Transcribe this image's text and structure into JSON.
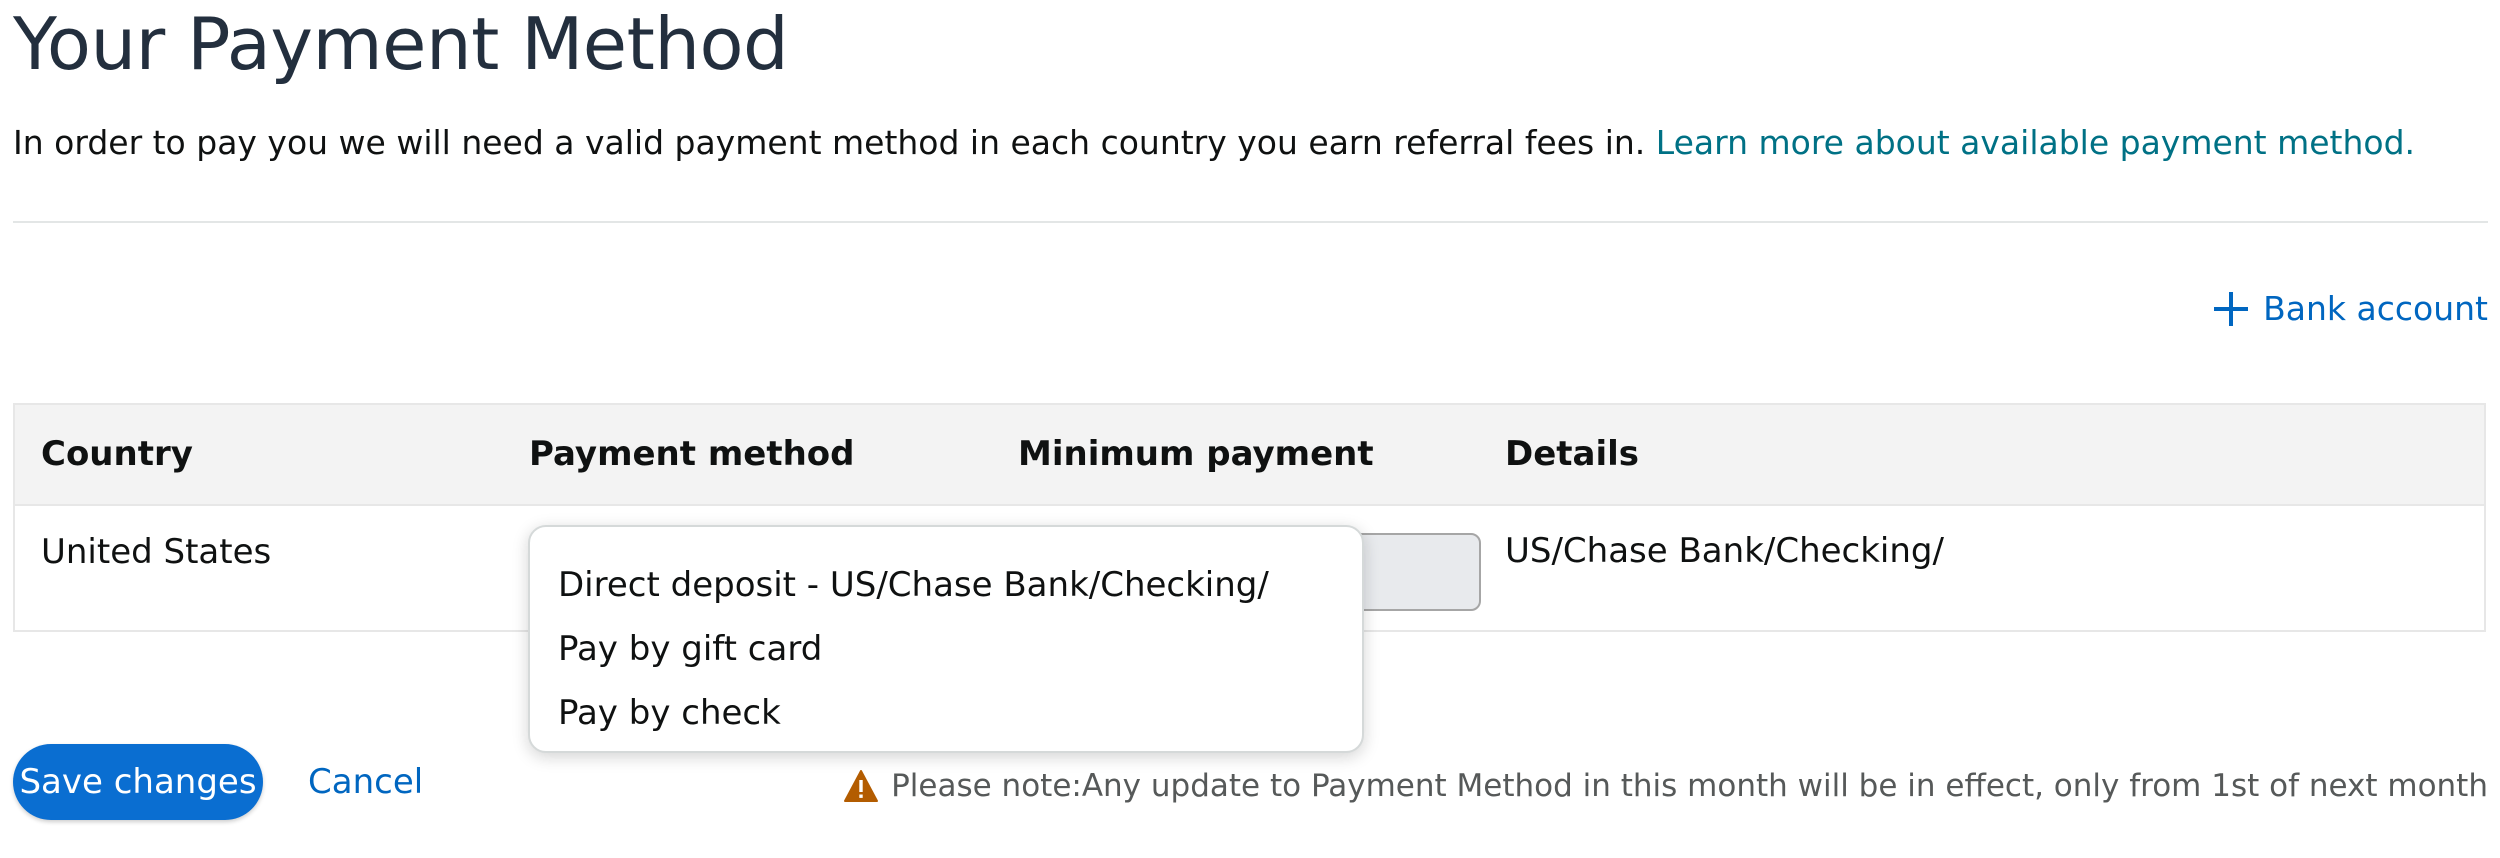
{
  "page": {
    "title": "Your Payment Method",
    "intro_text": "In order to pay you we will need a valid payment method in each country you earn referral fees in. ",
    "intro_link": "Learn more about available payment method."
  },
  "actions": {
    "add_bank_label": "Bank account",
    "save_label": "Save changes",
    "cancel_label": "Cancel"
  },
  "table": {
    "headers": [
      "Country",
      "Payment method",
      "Minimum payment",
      "Details"
    ],
    "rows": [
      {
        "country": "United States",
        "payment_method": "Direct deposit - US/Chase Bank/Checking/",
        "minimum_payment": "",
        "details": "US/Chase Bank/Checking/"
      }
    ]
  },
  "payment_dropdown": {
    "options": [
      "Direct deposit - US/Chase Bank/Checking/",
      "Pay by gift card",
      "Pay by check"
    ]
  },
  "note": {
    "text": "Please note:Any update to Payment Method in this month will be in effect, only from 1st of next month"
  },
  "colors": {
    "link": "#007185",
    "action_link": "#0066c0",
    "primary_button": "#0a6ed1",
    "warning": "#b35c00",
    "header_bg": "#f3f3f3",
    "title": "#232f3e"
  },
  "icons": {
    "add": "plus-icon",
    "warning": "warning-icon"
  }
}
